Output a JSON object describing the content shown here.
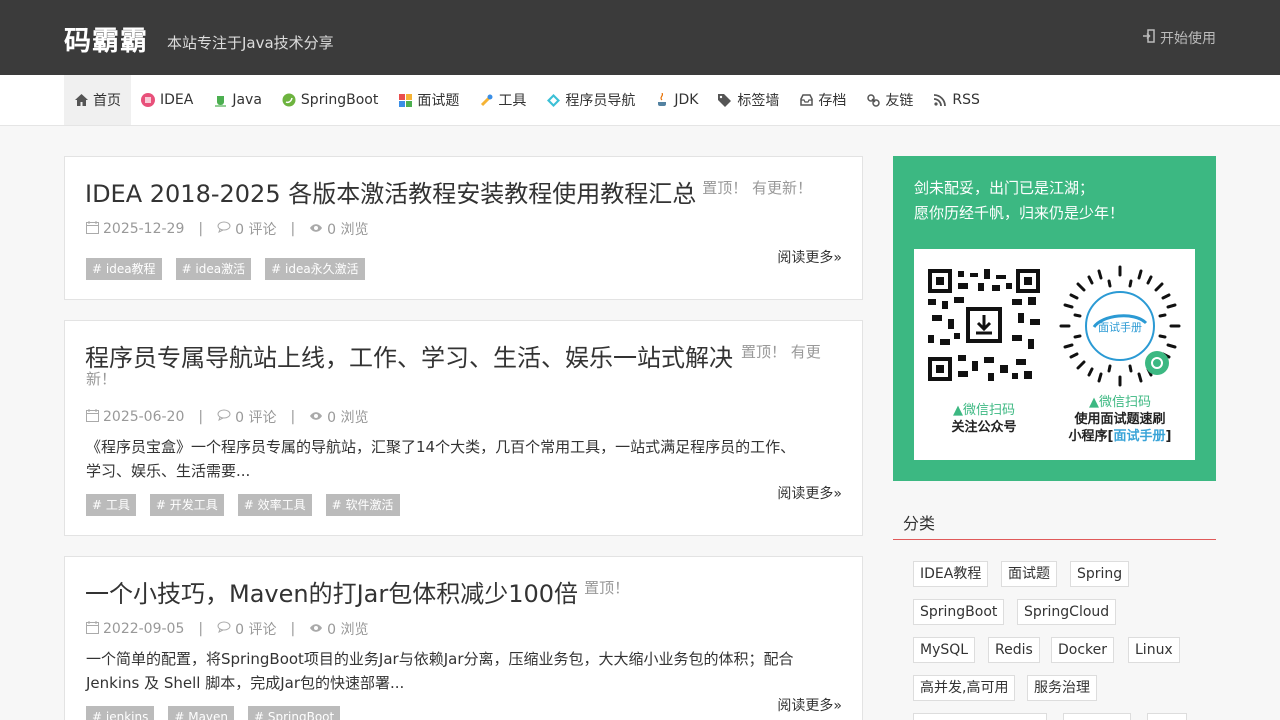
{
  "header": {
    "logo": "码霸霸",
    "tagline": "本站专注于Java技术分享",
    "start_label": "开始使用"
  },
  "nav": {
    "items": [
      {
        "label": "首页",
        "icon": "home-icon"
      },
      {
        "label": "IDEA",
        "icon": "idea-icon"
      },
      {
        "label": "Java",
        "icon": "java-icon"
      },
      {
        "label": "SpringBoot",
        "icon": "spring-icon"
      },
      {
        "label": "面试题",
        "icon": "interview-icon"
      },
      {
        "label": "工具",
        "icon": "tools-icon"
      },
      {
        "label": "程序员导航",
        "icon": "navigation-icon"
      },
      {
        "label": "JDK",
        "icon": "jdk-icon"
      },
      {
        "label": "标签墙",
        "icon": "tags-icon"
      },
      {
        "label": "存档",
        "icon": "archive-icon"
      },
      {
        "label": "友链",
        "icon": "link-icon"
      },
      {
        "label": "RSS",
        "icon": "rss-icon"
      }
    ]
  },
  "posts": [
    {
      "title": "IDEA 2018-2025 各版本激活教程安装教程使用教程汇总",
      "flag": "置顶！ 有更新！",
      "date": "2025-12-29",
      "comments": "0 评论",
      "views": "0 浏览",
      "readmore": "阅读更多»",
      "tags": [
        "# idea教程",
        "# idea激活",
        "# idea永久激活"
      ]
    },
    {
      "title": "程序员专属导航站上线，工作、学习、生活、娱乐一站式解决",
      "flag_line1": "置顶！ 有更",
      "flag_line2": "新！",
      "date": "2025-06-20",
      "comments": "0 评论",
      "views": "0 浏览",
      "excerpt_line1": "《程序员宝盒》一个程序员专属的导航站，汇聚了14个大类，几百个常用工具，一站式满足程序员的工作、",
      "excerpt_line2": "学习、娱乐、生活需要...",
      "readmore": "阅读更多»",
      "tags": [
        "# 工具",
        "# 开发工具",
        "# 效率工具",
        "# 软件激活"
      ]
    },
    {
      "title": "一个小技巧，Maven的打Jar包体积减少100倍",
      "flag": "置顶！",
      "date": "2022-09-05",
      "comments": "0 评论",
      "views": "0 浏览",
      "excerpt_line1": "一个简单的配置，将SpringBoot项目的业务Jar与依赖Jar分离，压缩业务包，大大缩小业务包的体积；配合",
      "excerpt_line2": "Jenkins 及 Shell 脚本，完成Jar包的快速部署...",
      "readmore": "阅读更多»",
      "tags": [
        "# jenkins",
        "# Maven",
        "# SpringBoot"
      ]
    }
  ],
  "sidebar": {
    "promo_line1": "剑未配妥，出门已是江湖；",
    "promo_line2": "愿你历经千帆，归来仍是少年！",
    "qr1_caption1": "▲微信扫码",
    "qr1_caption2": "关注公众号",
    "qr2_caption1": "▲微信扫码",
    "qr2_caption2": "使用面试题速刷",
    "qr2_caption3a": "小程序[",
    "qr2_caption3b": "面试手册",
    "qr2_caption3c": "]",
    "qr2_logo_text": "面试手册",
    "category_title": "分类",
    "categories": [
      "IDEA教程",
      "面试题",
      "Spring",
      "SpringBoot",
      "SpringCloud",
      "MySQL",
      "Redis",
      "Docker",
      "Linux",
      "高并发,高可用",
      "服务治理"
    ]
  },
  "colors": {
    "header_bg": "#3b3b3b",
    "promo_bg": "#3cb882",
    "accent_red": "#e05a5a",
    "tag_bg": "#bbbbbb"
  }
}
